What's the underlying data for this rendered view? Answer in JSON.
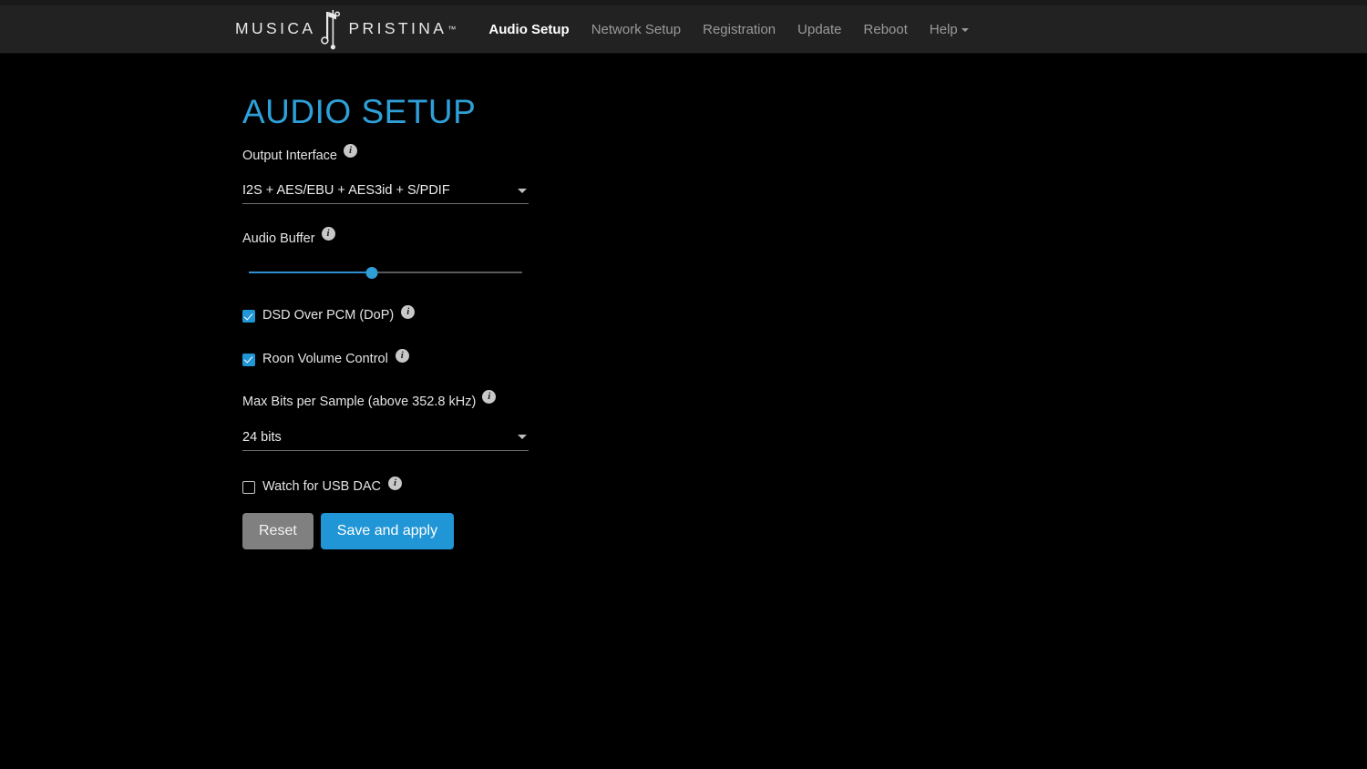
{
  "brand": {
    "word_left": "MUSICA",
    "word_right": "PRISTINA",
    "trademark": "™",
    "note_icon": "music-note-icon"
  },
  "nav": {
    "items": [
      {
        "label": "Audio Setup",
        "active": true,
        "has_caret": false
      },
      {
        "label": "Network Setup",
        "active": false,
        "has_caret": false
      },
      {
        "label": "Registration",
        "active": false,
        "has_caret": false
      },
      {
        "label": "Update",
        "active": false,
        "has_caret": false
      },
      {
        "label": "Reboot",
        "active": false,
        "has_caret": false
      },
      {
        "label": "Help",
        "active": false,
        "has_caret": true
      }
    ]
  },
  "page": {
    "title": "AUDIO SETUP"
  },
  "fields": {
    "output_interface": {
      "label": "Output Interface",
      "value": "I2S + AES/EBU + AES3id + S/PDIF",
      "info": "i"
    },
    "audio_buffer": {
      "label": "Audio Buffer",
      "info": "i",
      "percent": 45
    },
    "dsd_over_pcm": {
      "label": "DSD Over PCM (DoP)",
      "checked": true,
      "info": "i"
    },
    "roon_volume_control": {
      "label": "Roon Volume Control",
      "checked": true,
      "info": "i"
    },
    "max_bits_per_sample": {
      "label": "Max Bits per Sample (above 352.8 kHz)",
      "value": "24 bits",
      "info": "i"
    },
    "watch_for_usb_dac": {
      "label": "Watch for USB DAC",
      "checked": false,
      "info": "i"
    }
  },
  "buttons": {
    "reset": "Reset",
    "save": "Save and apply"
  },
  "colors": {
    "accent_blue": "#2196d6",
    "title_blue": "#2f9fd8",
    "navbar_bg": "#222222",
    "page_bg": "#000000",
    "reset_gray": "#808080"
  }
}
